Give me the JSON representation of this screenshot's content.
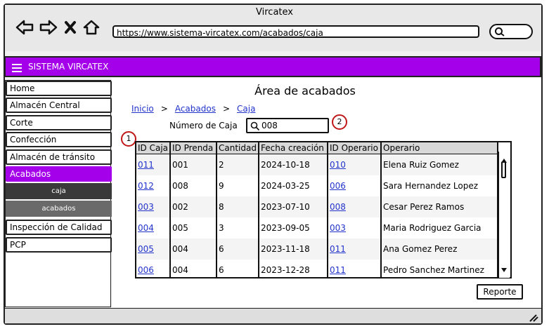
{
  "window": {
    "title": "Vircatex"
  },
  "browser": {
    "url": "https://www.sistema-vircatex.com/acabados/caja"
  },
  "appbar": {
    "brand": "SISTEMA VIRCATEX"
  },
  "sidebar": {
    "items": [
      {
        "label": "Home"
      },
      {
        "label": "Almacén Central"
      },
      {
        "label": "Corte"
      },
      {
        "label": "Confección"
      },
      {
        "label": "Almacén de tránsito"
      },
      {
        "label": "Acabados"
      },
      {
        "label": "caja"
      },
      {
        "label": "acabados"
      },
      {
        "label": "Inspección de Calidad"
      },
      {
        "label": "PCP"
      }
    ]
  },
  "main": {
    "title": "Área de acabados",
    "breadcrumb": [
      "Inicio",
      ">",
      "Acabados",
      ">",
      "Caja"
    ],
    "search_label": "Número de Caja",
    "search_value": "008",
    "badges": [
      "1",
      "2"
    ],
    "table": {
      "headers": [
        "ID Caja",
        "ID Prenda",
        "Cantidad",
        "Fecha creación",
        "ID Operario",
        "Operario"
      ],
      "rows": [
        [
          "011",
          "001",
          "2",
          "2024-10-18",
          "010",
          "Elena Ruiz Gomez"
        ],
        [
          "012",
          "008",
          "9",
          "2024-03-25",
          "006",
          "Sara Hernandez Lopez"
        ],
        [
          "003",
          "002",
          "8",
          "2023-07-10",
          "008",
          "Cesar Perez Ramos"
        ],
        [
          "004",
          "005",
          "3",
          "2023-09-05",
          "003",
          "Maria Rodriguez Garcia"
        ],
        [
          "005",
          "004",
          "6",
          "2023-11-18",
          "011",
          "Ana Gomez Perez"
        ],
        [
          "006",
          "004",
          "6",
          "2023-12-28",
          "011",
          "Pedro Sanchez Martinez"
        ]
      ]
    },
    "report_button": "Reporte"
  },
  "colors": {
    "accent": "#a400ea",
    "link": "#2233cc",
    "badge": "#c01818",
    "sub_dark": "#3a3a3a",
    "sub_mid": "#6a6a6a"
  },
  "icons": [
    "back-arrow-icon",
    "forward-arrow-icon",
    "close-icon",
    "home-icon",
    "search-icon",
    "hamburger-menu-icon",
    "resize-grip-icon"
  ]
}
